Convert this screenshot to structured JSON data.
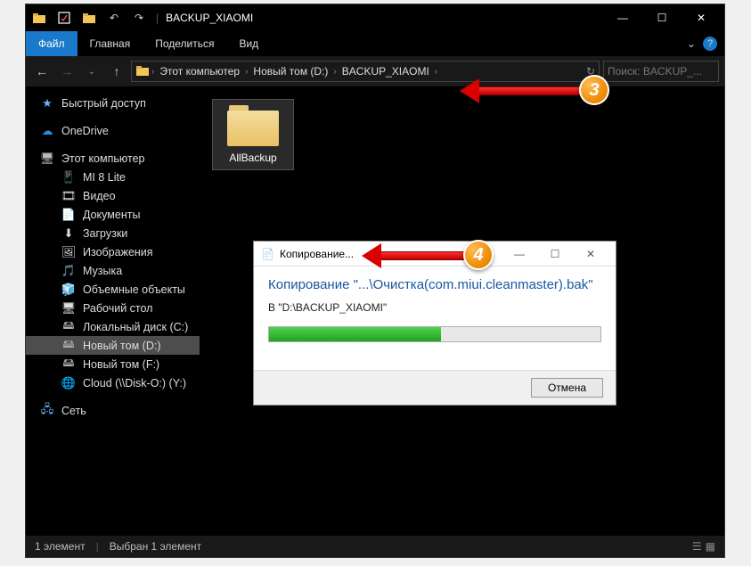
{
  "titlebar": {
    "title": "BACKUP_XIAOMI"
  },
  "ribbon": {
    "file": "Файл",
    "home": "Главная",
    "share": "Поделиться",
    "view": "Вид"
  },
  "breadcrumb": {
    "c1": "Этот компьютер",
    "c2": "Новый том (D:)",
    "c3": "BACKUP_XIAOMI"
  },
  "search": {
    "placeholder": "Поиск: BACKUP_..."
  },
  "sidebar": {
    "quick": "Быстрый доступ",
    "onedrive": "OneDrive",
    "pc": "Этот компьютер",
    "mi8": "MI 8 Lite",
    "video": "Видео",
    "docs": "Документы",
    "downloads": "Загрузки",
    "pictures": "Изображения",
    "music": "Музыка",
    "objects3d": "Объемные объекты",
    "desktop": "Рабочий стол",
    "driveC": "Локальный диск (C:)",
    "driveD": "Новый том (D:)",
    "driveF": "Новый том (F:)",
    "cloud": "Cloud (\\\\Disk-O:) (Y:)",
    "network": "Сеть"
  },
  "content": {
    "folder1": "AllBackup"
  },
  "status": {
    "count": "1 элемент",
    "selected": "Выбран 1 элемент"
  },
  "dialog": {
    "title": "Копирование...",
    "heading": "Копирование \"...\\Очистка(com.miui.cleanmaster).bak\"",
    "dest": "В \"D:\\BACKUP_XIAOMI\"",
    "cancel": "Отмена",
    "progress_pct": 52
  },
  "badges": {
    "b3": "3",
    "b4": "4"
  }
}
